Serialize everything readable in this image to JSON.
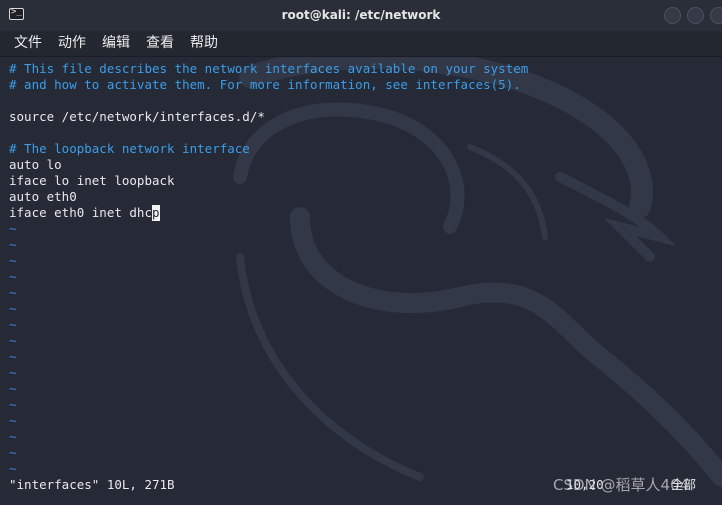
{
  "window": {
    "title": "root@kali: /etc/network"
  },
  "menu": {
    "items": [
      "文件",
      "动作",
      "编辑",
      "查看",
      "帮助"
    ]
  },
  "editor": {
    "lines": [
      {
        "text": "# This file describes the network interfaces available on your system",
        "kind": "comment"
      },
      {
        "text": "# and how to activate them. For more information, see interfaces(5).",
        "kind": "comment"
      },
      {
        "text": "",
        "kind": "blank"
      },
      {
        "text": "source /etc/network/interfaces.d/*",
        "kind": "code"
      },
      {
        "text": "",
        "kind": "blank"
      },
      {
        "text": "# The loopback network interface",
        "kind": "comment"
      },
      {
        "text": "auto lo",
        "kind": "code"
      },
      {
        "text": "iface lo inet loopback",
        "kind": "code"
      },
      {
        "text": "auto eth0",
        "kind": "code"
      }
    ],
    "cursor_line": {
      "before": "iface eth0 inet dhc",
      "cursor_char": "p"
    },
    "tilde_char": "~",
    "tilde_count": 16
  },
  "status": {
    "file_info": "\"interfaces\" 10L, 271B",
    "position": "10,20",
    "scroll": "全部"
  },
  "watermark": "CSDN @稻草人404",
  "colors": {
    "comment": "#3b9de8",
    "tilde": "#3b7fd6",
    "background": "#252a36",
    "text": "#e9e9ec"
  }
}
